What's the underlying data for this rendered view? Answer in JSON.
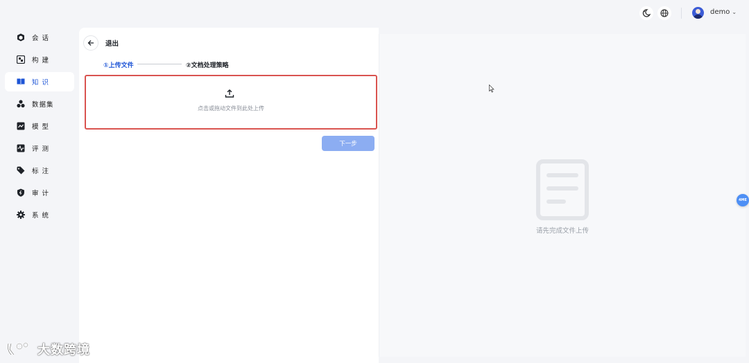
{
  "header": {
    "user_name": "demo",
    "icons": [
      "theme-toggle-icon",
      "globe-icon"
    ]
  },
  "sidebar": {
    "items": [
      {
        "label": "会 话",
        "icon": "cube-icon"
      },
      {
        "label": "构 建",
        "icon": "build-icon"
      },
      {
        "label": "知 识",
        "icon": "book-icon",
        "active": true
      },
      {
        "label": "数据集",
        "icon": "dataset-icon"
      },
      {
        "label": "模 型",
        "icon": "model-icon"
      },
      {
        "label": "评 测",
        "icon": "evaluation-icon"
      },
      {
        "label": "标 注",
        "icon": "tag-icon"
      },
      {
        "label": "审 计",
        "icon": "shield-icon"
      },
      {
        "label": "系 统",
        "icon": "gear-icon"
      }
    ]
  },
  "main": {
    "back_label": "退出",
    "steps": [
      "①上传文件",
      "②文档处理策略"
    ],
    "upload_hint": "点击或拖动文件到此处上传",
    "next_label": "下一步",
    "preview_empty_text": "请先完成文件上传"
  },
  "badge": "4ME",
  "watermark": "大数跨境",
  "colors": {
    "accent": "#1e55d6",
    "next_button": "#8cadf2",
    "highlight_border": "#d9534f"
  }
}
